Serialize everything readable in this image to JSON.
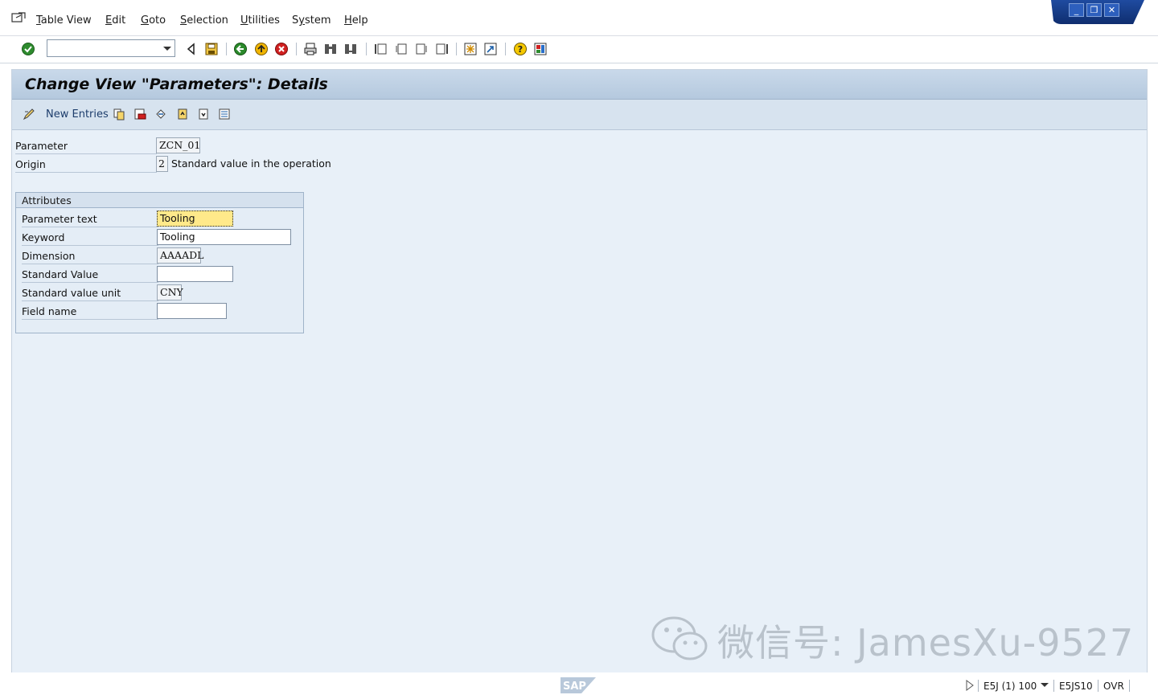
{
  "menubar": {
    "items": [
      "Table View",
      "Edit",
      "Goto",
      "Selection",
      "Utilities",
      "System",
      "Help"
    ],
    "accel": [
      "T",
      "E",
      "G",
      "S",
      "U",
      "y",
      "H"
    ]
  },
  "window_controls": {
    "minimize": "_",
    "restore": "❐",
    "close": "✕"
  },
  "toolbar": {
    "command_field_value": ""
  },
  "screen": {
    "title": "Change View \"Parameters\": Details",
    "new_entries_label": "New Entries"
  },
  "header_fields": {
    "parameter_label": "Parameter",
    "parameter_value": "ZCN_01",
    "origin_label": "Origin",
    "origin_value": "2",
    "origin_text": "Standard value in the operation"
  },
  "attributes": {
    "title": "Attributes",
    "rows": [
      {
        "label": "Parameter text",
        "value": "Tooling"
      },
      {
        "label": "Keyword",
        "value": "Tooling"
      },
      {
        "label": "Dimension",
        "value": "AAAADL"
      },
      {
        "label": "Standard Value",
        "value": ""
      },
      {
        "label": "Standard value unit",
        "value": "CNY"
      },
      {
        "label": "Field name",
        "value": ""
      }
    ]
  },
  "watermark": {
    "text": "微信号: JamesXu-9527"
  },
  "statusbar": {
    "system": "E5J (1) 100",
    "server": "E5JS10",
    "mode": "OVR",
    "logo": "SAP"
  },
  "colors": {
    "title_bar": "#c9d9ea",
    "workspace": "#e8f0f8",
    "highlight_field": "#ffe98a",
    "window_controls": "#1f4ba0"
  }
}
